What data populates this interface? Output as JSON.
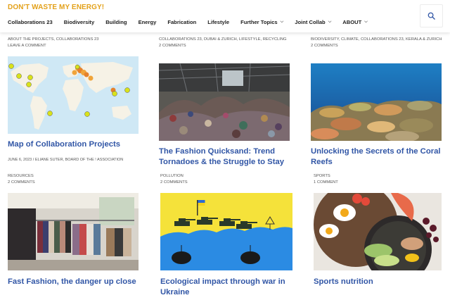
{
  "site": {
    "title": "DON'T WASTE MY ENERGY!"
  },
  "nav": {
    "items": [
      {
        "label": "Collaborations 23"
      },
      {
        "label": "Biodiversity"
      },
      {
        "label": "Building"
      },
      {
        "label": "Energy"
      },
      {
        "label": "Fabrication"
      },
      {
        "label": "Lifestyle"
      },
      {
        "label": "Further Topics",
        "dropdown": true
      },
      {
        "label": "Joint Collab",
        "dropdown": true
      },
      {
        "label": "ABOUT",
        "dropdown": true
      }
    ],
    "search_icon": "search-icon"
  },
  "posts": [
    {
      "categories": "ABOUT THE PROJECTS, COLLABORATIONS 23",
      "comments": "LEAVE A COMMENT",
      "thumb": "world-map",
      "title": "Map of Collaboration Projects",
      "byline": "JUNE 6, 2023 / ELIANE SUTER, BOARD OF THE ! ASSOCIATION"
    },
    {
      "categories": "COLLABORATIONS 23, DUBAI & ZURICH, LIFESTYLE, RECYCLING",
      "comments": "2 COMMENTS",
      "thumb": "clothing-warehouse",
      "title": "The Fashion Quicksand: Trend Tornadoes & the Struggle to Stay"
    },
    {
      "categories": "BIODIVERSITY, CLIMATE, COLLABORATIONS 23, KERALA & ZURICH",
      "comments": "2 COMMENTS",
      "thumb": "coral-reef",
      "title": "Unlocking the Secrets of the Coral Reefs"
    },
    {
      "categories": "RESOURCES",
      "comments": "2 COMMENTS",
      "thumb": "clothing-store",
      "title": "Fast Fashion, the danger up close"
    },
    {
      "categories": "POLLUTION",
      "comments": "2 COMMENTS",
      "thumb": "war-drawing",
      "title": "Ecological impact through war in Ukraine"
    },
    {
      "categories": "SPORTS",
      "comments": "1 COMMENT",
      "thumb": "food-bowl",
      "title": "Sports nutrition"
    }
  ],
  "colors": {
    "site_title": "#e3a11a",
    "post_title": "#3156a6",
    "text": "#333333"
  }
}
